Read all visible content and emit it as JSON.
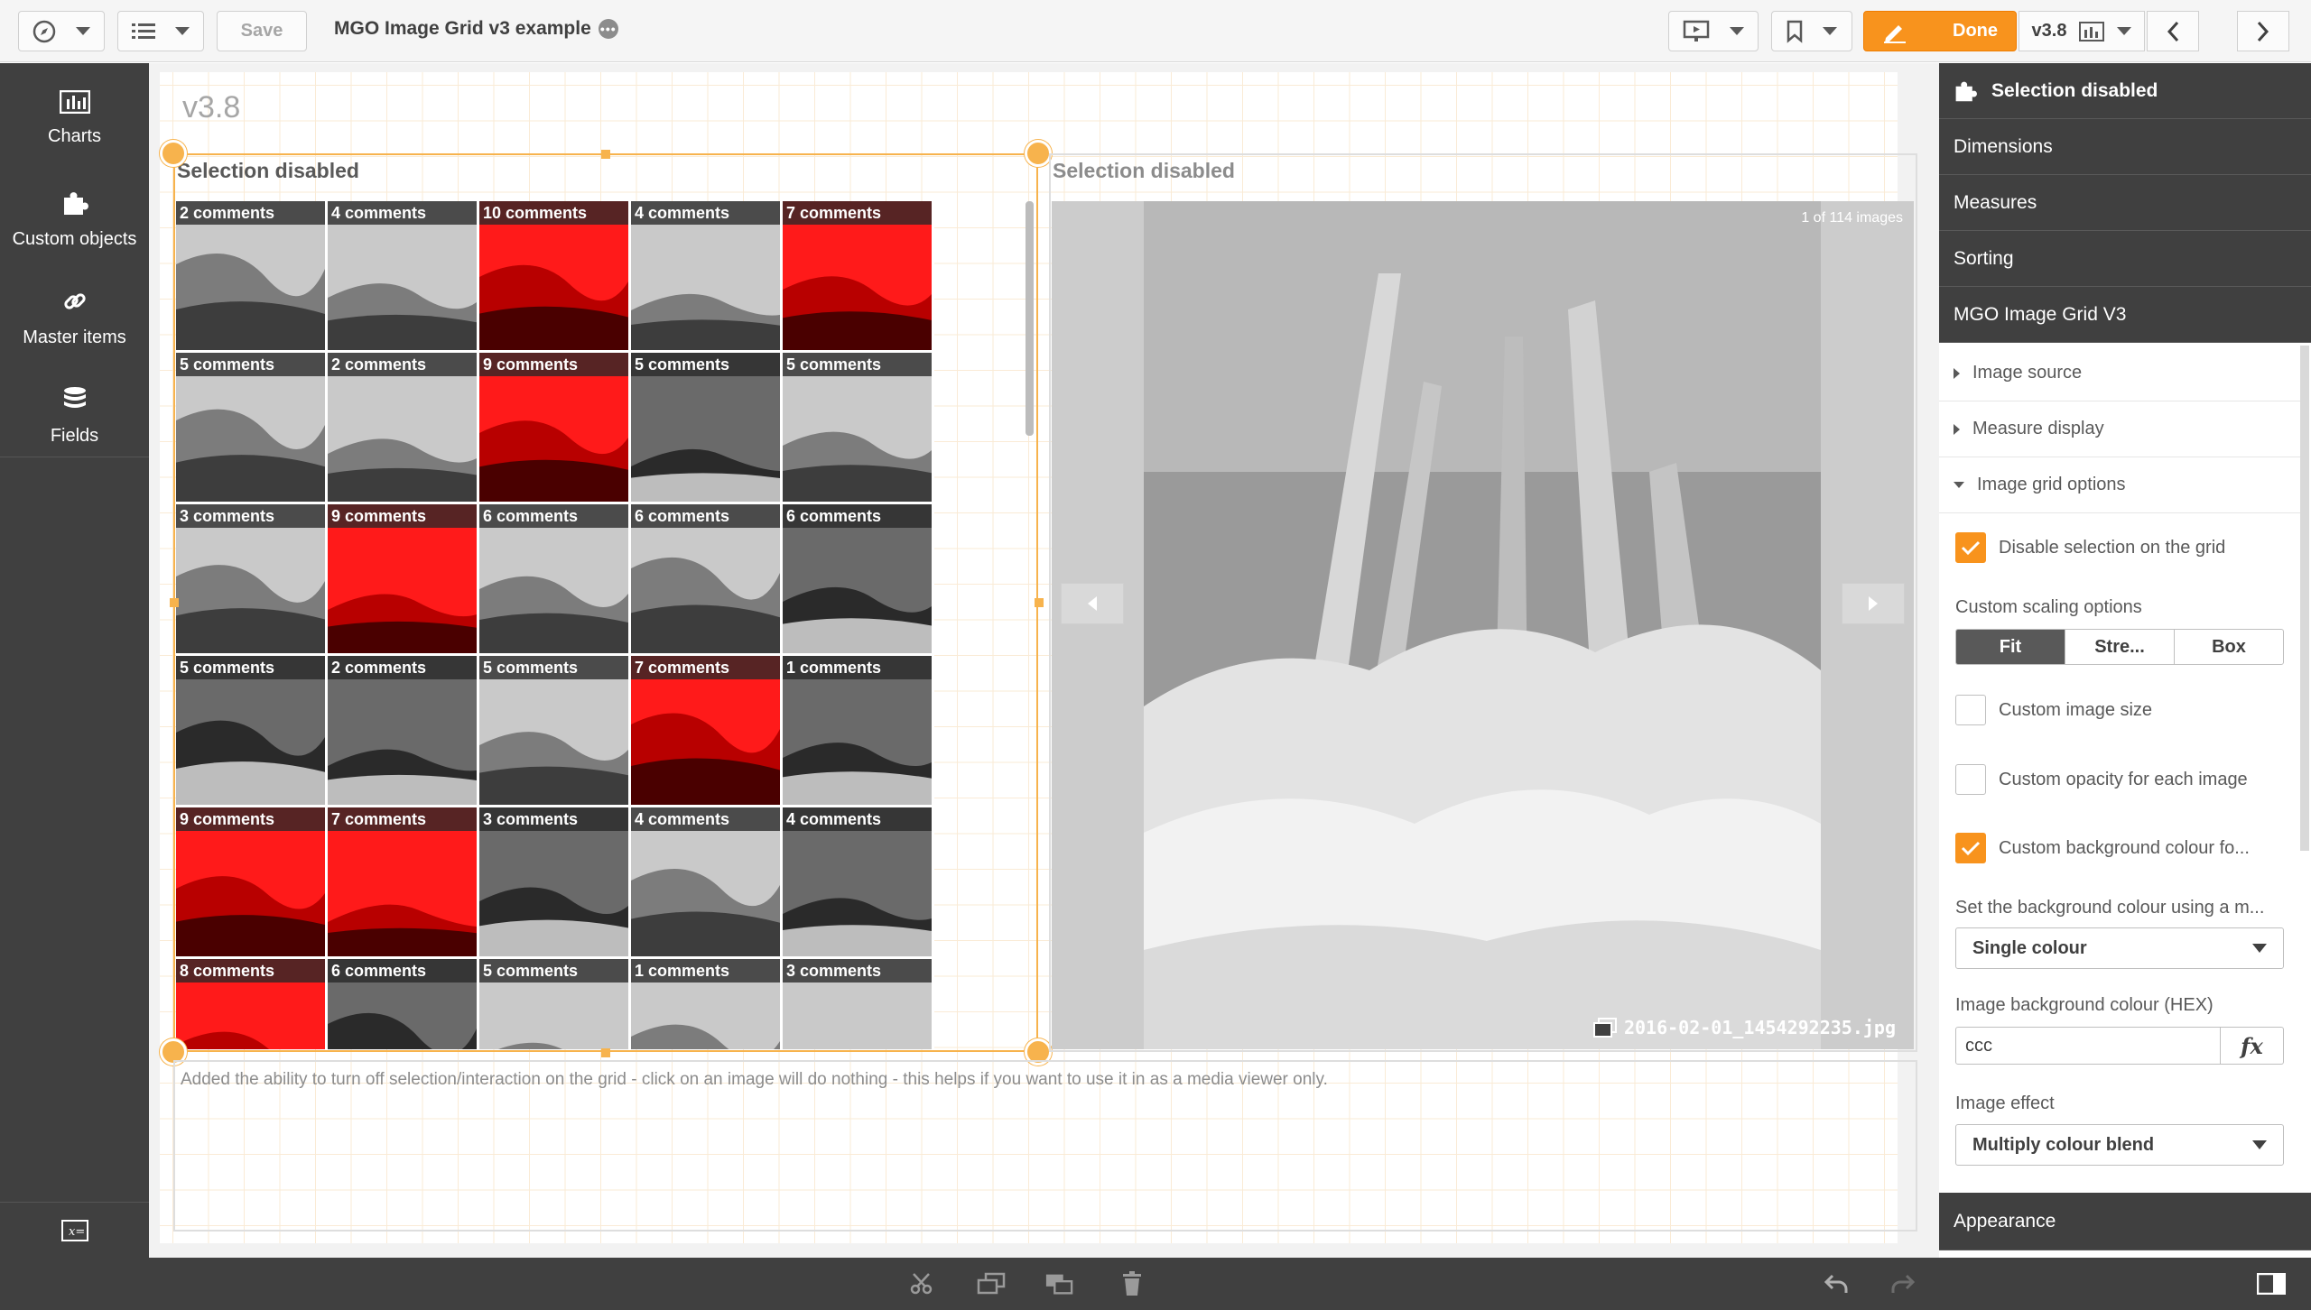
{
  "toolbar": {
    "save_label": "Save",
    "app_title": "MGO Image Grid v3 example",
    "done_label": "Done",
    "version_label": "v3.8",
    "accent_color": "#f8931d"
  },
  "leftnav": {
    "items": [
      {
        "label": "Charts",
        "icon": "bar-chart-icon"
      },
      {
        "label": "Custom objects",
        "icon": "puzzle-icon"
      },
      {
        "label": "Master items",
        "icon": "link-icon"
      },
      {
        "label": "Fields",
        "icon": "database-icon"
      }
    ]
  },
  "sheet": {
    "title": "v3.8",
    "grid_object": {
      "title": "Selection disabled",
      "thumbnails": [
        {
          "label": "2 comments",
          "tone": "gray"
        },
        {
          "label": "4 comments",
          "tone": "gray"
        },
        {
          "label": "10 comments",
          "tone": "red"
        },
        {
          "label": "4 comments",
          "tone": "gray"
        },
        {
          "label": "7 comments",
          "tone": "red"
        },
        {
          "label": "5 comments",
          "tone": "gray"
        },
        {
          "label": "2 comments",
          "tone": "gray"
        },
        {
          "label": "9 comments",
          "tone": "red"
        },
        {
          "label": "5 comments",
          "tone": "dark"
        },
        {
          "label": "5 comments",
          "tone": "gray"
        },
        {
          "label": "3 comments",
          "tone": "gray"
        },
        {
          "label": "9 comments",
          "tone": "red"
        },
        {
          "label": "6 comments",
          "tone": "gray"
        },
        {
          "label": "6 comments",
          "tone": "gray"
        },
        {
          "label": "6 comments",
          "tone": "dark"
        },
        {
          "label": "5 comments",
          "tone": "dark"
        },
        {
          "label": "2 comments",
          "tone": "dark"
        },
        {
          "label": "5 comments",
          "tone": "gray"
        },
        {
          "label": "7 comments",
          "tone": "red"
        },
        {
          "label": "1 comments",
          "tone": "dark"
        },
        {
          "label": "9 comments",
          "tone": "red"
        },
        {
          "label": "7 comments",
          "tone": "red"
        },
        {
          "label": "3 comments",
          "tone": "dark"
        },
        {
          "label": "4 comments",
          "tone": "gray"
        },
        {
          "label": "4 comments",
          "tone": "dark"
        },
        {
          "label": "8 comments",
          "tone": "red"
        },
        {
          "label": "6 comments",
          "tone": "dark"
        },
        {
          "label": "5 comments",
          "tone": "gray"
        },
        {
          "label": "1 comments",
          "tone": "gray"
        },
        {
          "label": "3 comments",
          "tone": "gray"
        }
      ]
    },
    "viewer_object": {
      "title": "Selection disabled",
      "counter": "1 of 114 images",
      "filename": "2016-02-01_1454292235.jpg"
    },
    "text_object": {
      "text": "Added the ability to turn off selection/interaction on the grid - click on an image will do nothing - this helps if you want to use it in as a media viewer only."
    }
  },
  "rightpanel": {
    "header": "Selection disabled",
    "sections": [
      "Dimensions",
      "Measures",
      "Sorting",
      "MGO Image Grid V3"
    ],
    "subsections": [
      "Image source",
      "Measure display",
      "Image grid options"
    ],
    "disable_selection_label": "Disable selection on the grid",
    "disable_selection_checked": true,
    "scaling_label": "Custom scaling options",
    "scaling_options": [
      "Fit",
      "Stre...",
      "Box"
    ],
    "scaling_selected": "Fit",
    "custom_size_label": "Custom image size",
    "custom_size_checked": false,
    "custom_opacity_label": "Custom opacity for each image",
    "custom_opacity_checked": false,
    "custom_bg_label": "Custom background colour fo...",
    "custom_bg_checked": true,
    "bg_mode_label": "Set the background colour using a m...",
    "bg_mode_value": "Single colour",
    "bg_hex_label": "Image background colour (HEX)",
    "bg_hex_value": "ccc",
    "fx_label": "fx",
    "effect_label": "Image effect",
    "effect_value": "Multiply colour blend",
    "appearance_label": "Appearance"
  }
}
